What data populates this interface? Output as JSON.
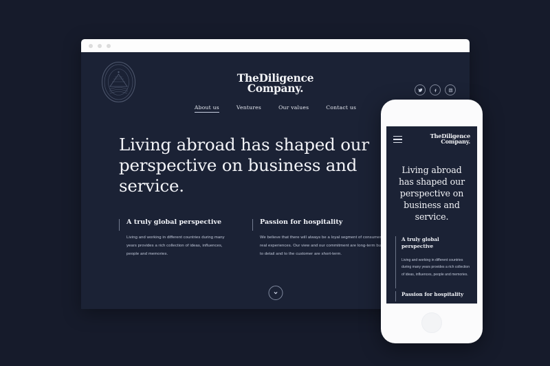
{
  "theme": {
    "page_bg": "#161b2b",
    "screen_bg": "#1b2235",
    "browser_bar_bg": "#fdfdfd",
    "phone_body": "#fbfbfc",
    "text_primary": "#f3f4f8",
    "text_body": "#c2c9da"
  },
  "browser": {
    "traffic_lights": [
      "dot",
      "dot",
      "dot"
    ]
  },
  "site": {
    "brand": {
      "line1": "TheDiligence",
      "line2": "Company.",
      "crest_icon": "crest-seal-icon"
    },
    "nav": [
      {
        "label": "About us",
        "active": true
      },
      {
        "label": "Ventures",
        "active": false
      },
      {
        "label": "Our values",
        "active": false
      },
      {
        "label": "Contact us",
        "active": false
      }
    ],
    "socials": [
      {
        "name": "twitter-icon",
        "label": "Twitter"
      },
      {
        "name": "facebook-icon",
        "label": "Facebook"
      },
      {
        "name": "instagram-icon",
        "label": "Instagram"
      }
    ],
    "hero": {
      "headline": "Living abroad has shaped our perspective on business and service."
    },
    "columns": [
      {
        "heading": "A truly global perspective",
        "body": "Living and working in different countries during many years provides a rich collection of ideas, influences, people and memories."
      },
      {
        "heading": "Passion for hospitality",
        "body": "We believe that there will always be a loyal segment of consumers that seek real experiences. Our view and our commitment are long-term but our attention to detail and to the customer are short-term."
      }
    ],
    "scroll_down": {
      "icon": "chevron-down-icon"
    }
  },
  "phone": {
    "menu_icon": "hamburger-menu-icon",
    "brand": {
      "line1": "TheDiligence",
      "line2": "Company."
    },
    "hero": {
      "headline": "Living abroad has shaped our perspective on business and service."
    },
    "columns": [
      {
        "heading": "A truly global perspective",
        "body": "Living and working in different countries during many years provides a rich collection of ideas, influences, people and memories."
      },
      {
        "heading": "Passion for hospitality",
        "body": ""
      }
    ],
    "home_button": "home-button"
  }
}
